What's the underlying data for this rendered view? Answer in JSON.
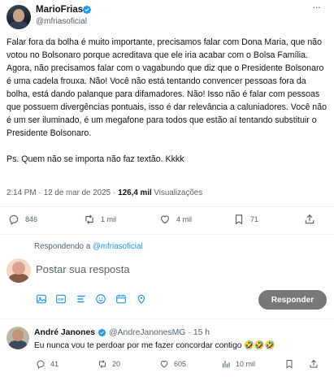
{
  "post": {
    "author_name": "MarioFrias",
    "author_handle": "@mfriasoficial",
    "more_label": "···",
    "body_paragraph": "Falar fora da bolha é muito importante, precisamos falar com Dona Maria, que não votou no Bolsonaro porque acreditava que ele iria acabar com o Bolsa Família. Agora, não precisamos falar com o vagabundo que diz que o Presidente Bolsonaro é uma cadela frouxa. Não! Você não está tentando convencer pessoas fora da bolha, está dando palanque para difamadores. Não! Isso não é falar com pessoas que possuem divergências pontuais, isso é dar relevância a caluniadores. Você não é um ser iluminado, é um megafone para todos que estão aí tentando substituir o Presidente Bolsonaro.",
    "body_ps": "Ps. Quem não se importa não faz textão. Kkkk",
    "time": "2:14 PM",
    "date": "12 de mar de 2025",
    "views_count": "126,4 mil",
    "views_label": "Visualizações",
    "actions": {
      "replies": "846",
      "reposts": "1 mil",
      "likes": "4 mil",
      "bookmarks": "71"
    }
  },
  "composer": {
    "replying_prefix": "Respondendo a",
    "replying_to": "@mfriasoficial",
    "placeholder": "Postar sua resposta",
    "reply_button": "Responder"
  },
  "reply": {
    "author_name": "André Janones",
    "author_handle": "@AndreJanonesMG",
    "time": "15 h",
    "text": "Eu nunca vou te perdoar por me fazer concordar contigo 🤣🤣🤣",
    "actions": {
      "replies": "41",
      "reposts": "20",
      "likes": "605",
      "views": "10 mil"
    }
  },
  "colors": {
    "accent": "#1d9bf0",
    "muted": "#536471",
    "text": "#0f1419",
    "reply_button_bg": "#787878",
    "verified_badge": "#1d9bf0"
  }
}
